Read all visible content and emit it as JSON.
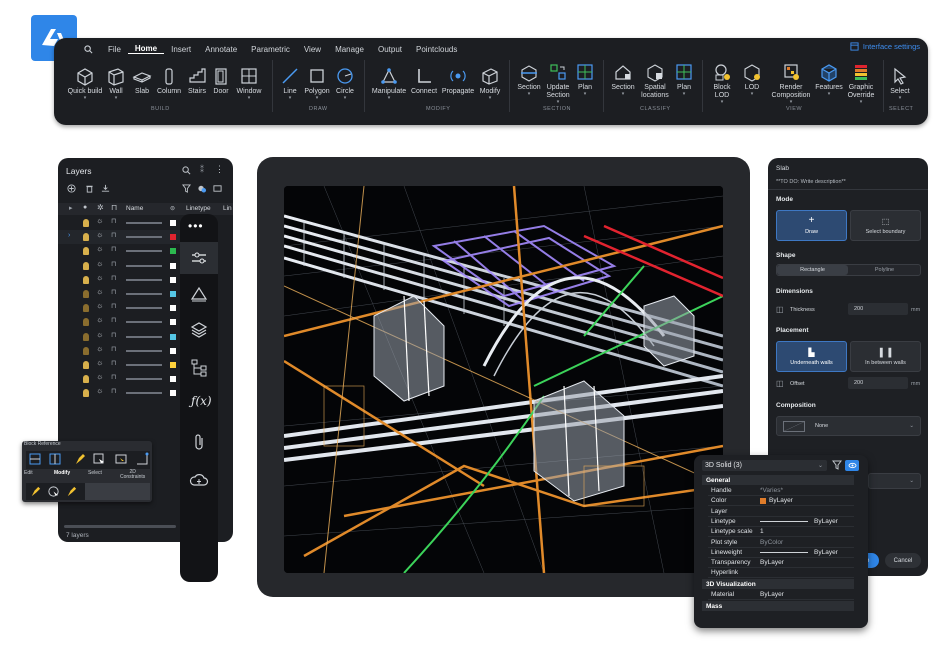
{
  "app": {
    "brand": "BricsCAD",
    "accent": "#2f86e8"
  },
  "menu": {
    "search_icon": "search-icon",
    "tabs": [
      "File",
      "Home",
      "Insert",
      "Annotate",
      "Parametric",
      "View",
      "Manage",
      "Output",
      "Pointclouds"
    ],
    "active": "Home",
    "interface_settings": "Interface settings"
  },
  "ribbon": {
    "tools": {
      "quick_build": "Quick build",
      "wall": "Wall",
      "slab": "Slab",
      "column": "Column",
      "stairs": "Stairs",
      "door": "Door",
      "window": "Window",
      "line": "Line",
      "polygon": "Polygon",
      "circle": "Circle",
      "manipulate": "Manipulate",
      "connect": "Connect",
      "propagate": "Propagate",
      "modify": "Modify",
      "section": "Section",
      "update_section_1": "Update",
      "update_section_2": "Section",
      "plan": "Plan",
      "section2": "Section",
      "spatial_1": "Spatial",
      "spatial_2": "locations",
      "plan2": "Plan",
      "block_lod_1": "Block",
      "block_lod_2": "LOD",
      "lod": "LOD",
      "render_1": "Render",
      "render_2": "Composition",
      "features": "Features",
      "graphic_1": "Graphic",
      "graphic_2": "Override",
      "select": "Select"
    },
    "groups": {
      "build": "BUILD",
      "draw": "DRAW",
      "modify": "MODIFY",
      "section": "SECTION",
      "classify": "CLASSIFY",
      "view": "VIEW",
      "select": "SELECT"
    }
  },
  "layers": {
    "title": "Layers",
    "col_name": "Name",
    "col_linetype": "Linetype",
    "col_lin2": "Lin",
    "count": "7 layers",
    "swatches": [
      "#ffffff",
      "#e0242f",
      "#2cb94f",
      "#ffffff",
      "#ffffff",
      "#55c7e6",
      "#ffffff",
      "#ffffff",
      "#55c7e6",
      "#ffffff",
      "#ffd23c",
      "#ffffff",
      "#ffffff"
    ]
  },
  "block_reference": {
    "title": "Block Reference",
    "labels": {
      "edit": "Edit",
      "modify": "Modify",
      "select": "Select",
      "constraints_1": "2D",
      "constraints_2": "Constraints"
    }
  },
  "slab": {
    "title": "Slab",
    "description": "**TO DO: Write description**",
    "mode_label": "Mode",
    "mode_draw": "Draw",
    "mode_select_boundary": "Select boundary",
    "shape_label": "Shape",
    "shape_rectangle": "Rectangle",
    "shape_polyline": "Polyline",
    "dimensions_label": "Dimensions",
    "thickness_label": "Thickness",
    "thickness_value": "200",
    "thickness_unit": "mm",
    "placement_label": "Placement",
    "placement_under": "Underneath walls",
    "placement_between": "In between walls",
    "offset_label": "Offset",
    "offset_value": "200",
    "offset_unit": "mm",
    "composition_label": "Composition",
    "composition_value": "None",
    "ok_button": "ne",
    "cancel_button": "Cancel"
  },
  "properties": {
    "selector": "3D Solid (3)",
    "general": "General",
    "rows": [
      {
        "k": "Handle",
        "v": "*Varies*"
      },
      {
        "k": "Color",
        "v": "ByLayer"
      },
      {
        "k": "Layer",
        "v": ""
      },
      {
        "k": "Linetype",
        "v": "ByLayer"
      },
      {
        "k": "Linetype scale",
        "v": "1"
      },
      {
        "k": "Plot style",
        "v": "ByColor"
      },
      {
        "k": "Lineweight",
        "v": "ByLayer"
      },
      {
        "k": "Transparency",
        "v": "ByLayer"
      },
      {
        "k": "Hyperlink",
        "v": ""
      }
    ],
    "visualization": "3D Visualization",
    "material_k": "Material",
    "material_v": "ByLayer",
    "mass": "Mass",
    "color_swatch": "#e07c2a"
  }
}
